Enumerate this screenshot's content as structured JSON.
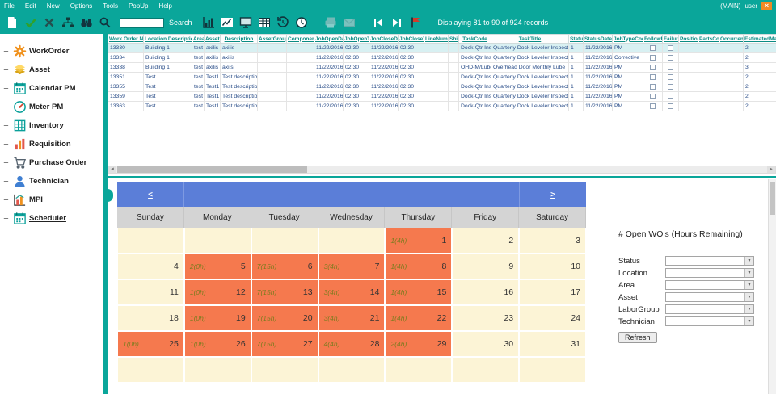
{
  "menubar": {
    "items": [
      "File",
      "Edit",
      "New",
      "Options",
      "Tools",
      "PopUp",
      "Help"
    ],
    "right_main": "(MAIN)",
    "right_user": "user",
    "close_label": "×"
  },
  "toolbar": {
    "search_label": "Search",
    "search_value": "",
    "record_status": "Displaying 81 to 90 of 924 records"
  },
  "sidebar": {
    "items": [
      {
        "label": "WorkOrder",
        "icon": "gear"
      },
      {
        "label": "Asset",
        "icon": "layers"
      },
      {
        "label": "Calendar PM",
        "icon": "calendar"
      },
      {
        "label": "Meter PM",
        "icon": "gauge"
      },
      {
        "label": "Inventory",
        "icon": "grid"
      },
      {
        "label": "Requisition",
        "icon": "bars"
      },
      {
        "label": "Purchase Order",
        "icon": "cart"
      },
      {
        "label": "Technician",
        "icon": "person"
      },
      {
        "label": "MPI",
        "icon": "chart"
      },
      {
        "label": "Scheduler",
        "icon": "calendar",
        "active": true
      }
    ]
  },
  "grid": {
    "columns": [
      "Work Order Number",
      "Location Description",
      "Area",
      "Asset",
      "Description",
      "AssetGroup",
      "Component",
      "JobOpenDate",
      "JobOpenTime",
      "JobCloseDate",
      "JobCloseTime",
      "LineNumber",
      "Shift",
      "TaskCode",
      "TaskTitle",
      "Status",
      "StatusDate",
      "JobTypeCode",
      "FollowUp",
      "Failure",
      "Position",
      "PartsCost",
      "Occurrence",
      "EstimatedManhours"
    ],
    "checkbox_columns": [
      18,
      19
    ],
    "rows": [
      {
        "selected": true,
        "cells": [
          "13330",
          "Building 1",
          "test",
          "axilis",
          "axilis",
          "",
          "",
          "11/22/2016",
          "02:30",
          "11/22/2016",
          "02:30",
          "",
          "",
          "Dock-Qtr Ins",
          "Quarterly Dock Leveler Inspection",
          "1",
          "11/22/2016",
          "PM",
          "",
          "",
          "",
          "",
          "",
          "2"
        ]
      },
      {
        "selected": false,
        "cells": [
          "13334",
          "Building 1",
          "test",
          "axilis",
          "axilis",
          "",
          "",
          "11/22/2016",
          "02:30",
          "11/22/2016",
          "02:30",
          "",
          "",
          "Dock-Qtr Ins",
          "Quarterly Dock Leveler Inspection",
          "1",
          "11/22/2016",
          "Corrective",
          "",
          "",
          "",
          "",
          "",
          "2"
        ]
      },
      {
        "selected": false,
        "cells": [
          "13338",
          "Building 1",
          "test",
          "axilis",
          "axils",
          "",
          "",
          "11/22/2016",
          "02:30",
          "11/22/2016",
          "02:30",
          "",
          "",
          "OHD-M/Lube",
          "Overhead Door Monthly Lube",
          "1",
          "11/22/2016",
          "PM",
          "",
          "",
          "",
          "",
          "",
          "3"
        ]
      },
      {
        "selected": false,
        "cells": [
          "13351",
          "Test",
          "test",
          "Test1",
          "Test description",
          "",
          "",
          "11/22/2016",
          "02:30",
          "11/22/2016",
          "02:30",
          "",
          "",
          "Dock-Qtr Ins",
          "Quarterly Dock Leveler Inspection",
          "1",
          "11/22/2016",
          "PM",
          "",
          "",
          "",
          "",
          "",
          "2"
        ]
      },
      {
        "selected": false,
        "cells": [
          "13355",
          "Test",
          "test",
          "Test1",
          "Test description",
          "",
          "",
          "11/22/2016",
          "02:30",
          "11/22/2016",
          "02:30",
          "",
          "",
          "Dock-Qtr Ins",
          "Quarterly Dock Leveler Inspection",
          "1",
          "11/22/2016",
          "PM",
          "",
          "",
          "",
          "",
          "",
          "2"
        ]
      },
      {
        "selected": false,
        "cells": [
          "13359",
          "Test",
          "test",
          "Test1",
          "Test description",
          "",
          "",
          "11/22/2016",
          "02:30",
          "11/22/2016",
          "02:30",
          "",
          "",
          "Dock-Qtr Ins",
          "Quarterly Dock Leveler Inspection",
          "1",
          "11/22/2016",
          "PM",
          "",
          "",
          "",
          "",
          "",
          "2"
        ]
      },
      {
        "selected": false,
        "cells": [
          "13363",
          "Test",
          "test",
          "Test1",
          "Test description",
          "",
          "",
          "11/22/2016",
          "02:30",
          "11/22/2016",
          "02:30",
          "",
          "",
          "Dock-Qtr Ins",
          "Quarterly Dock Leveler Inspection",
          "1",
          "11/22/2016",
          "PM",
          "",
          "",
          "",
          "",
          "",
          "2"
        ]
      }
    ]
  },
  "calendar": {
    "prev_label": "<",
    "next_label": ">",
    "day_headers": [
      "Sunday",
      "Monday",
      "Tuesday",
      "Wednesday",
      "Thursday",
      "Friday",
      "Saturday"
    ],
    "weeks": [
      [
        {},
        {},
        {},
        {},
        {
          "day": "1",
          "wo": "1(4h)"
        },
        {
          "day": "2"
        },
        {
          "day": "3"
        }
      ],
      [
        {
          "day": "4"
        },
        {
          "day": "5",
          "wo": "2(0h)"
        },
        {
          "day": "6",
          "wo": "7(15h)"
        },
        {
          "day": "7",
          "wo": "3(4h)"
        },
        {
          "day": "8",
          "wo": "1(4h)"
        },
        {
          "day": "9"
        },
        {
          "day": "10"
        }
      ],
      [
        {
          "day": "11"
        },
        {
          "day": "12",
          "wo": "1(0h)"
        },
        {
          "day": "13",
          "wo": "7(15h)"
        },
        {
          "day": "14",
          "wo": "3(4h)"
        },
        {
          "day": "15",
          "wo": "1(4h)"
        },
        {
          "day": "16"
        },
        {
          "day": "17"
        }
      ],
      [
        {
          "day": "18"
        },
        {
          "day": "19",
          "wo": "1(0h)"
        },
        {
          "day": "20",
          "wo": "7(15h)"
        },
        {
          "day": "21",
          "wo": "3(4h)"
        },
        {
          "day": "22",
          "wo": "1(4h)"
        },
        {
          "day": "23"
        },
        {
          "day": "24"
        }
      ],
      [
        {
          "day": "25",
          "wo": "1(0h)"
        },
        {
          "day": "26",
          "wo": "1(0h)"
        },
        {
          "day": "27",
          "wo": "7(15h)"
        },
        {
          "day": "28",
          "wo": "4(4h)"
        },
        {
          "day": "29",
          "wo": "2(4h)"
        },
        {
          "day": "30"
        },
        {
          "day": "31"
        }
      ],
      [
        {},
        {},
        {},
        {},
        {},
        {},
        {}
      ]
    ]
  },
  "panel": {
    "title": "# Open WO's (Hours Remaining)",
    "fields": [
      "Status",
      "Location",
      "Area",
      "Asset",
      "LaborGroup",
      "Technician"
    ],
    "refresh_label": "Refresh"
  },
  "colors": {
    "accent_teal": "#0aa69a",
    "calendar_orange": "#f5794e",
    "calendar_cream": "#fcf4d6",
    "nav_blue": "#5b7ed8",
    "close_orange": "#f08a24"
  }
}
